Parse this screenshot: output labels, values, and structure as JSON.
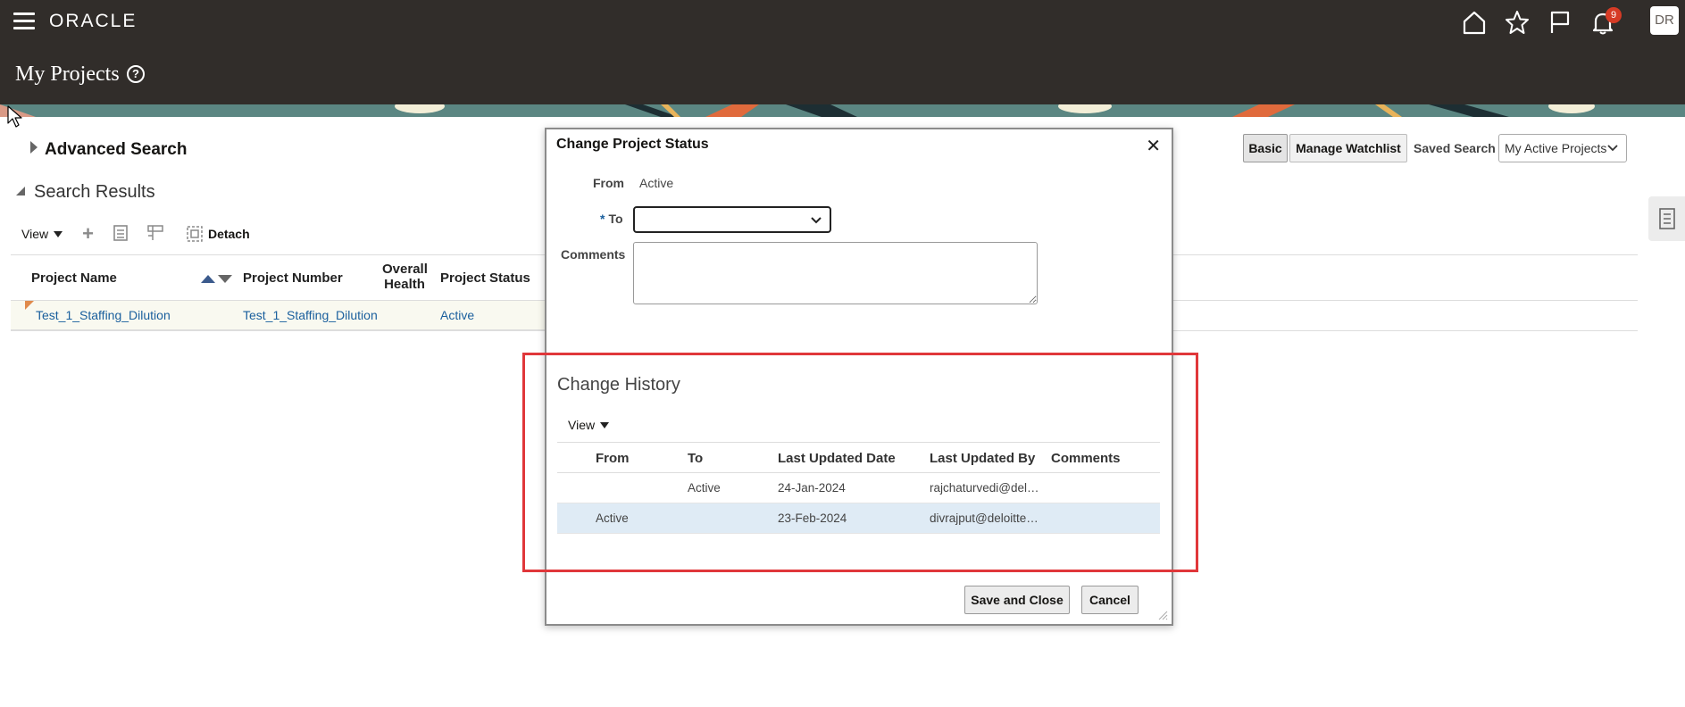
{
  "header": {
    "logo": "ORACLE",
    "page_title": "My Projects",
    "notification_count": "9",
    "avatar_initials": "DR",
    "colors": {
      "bar": "#312d2a",
      "badge": "#d63b25"
    }
  },
  "search": {
    "advanced_label": "Advanced Search",
    "results_label": "Search Results",
    "basic_button": "Basic",
    "watchlist_button": "Manage Watchlist",
    "saved_search_label": "Saved Search",
    "saved_search_value": "My Active Projects"
  },
  "toolbar": {
    "view_label": "View",
    "detach_label": "Detach"
  },
  "results_table": {
    "columns": {
      "name": "Project Name",
      "number": "Project Number",
      "health_line1": "Overall",
      "health_line2": "Health",
      "status": "Project Status"
    },
    "rows": [
      {
        "name": "Test_1_Staffing_Dilution",
        "number": "Test_1_Staffing_Dilution",
        "health": "",
        "status": "Active"
      }
    ]
  },
  "dialog": {
    "title": "Change Project Status",
    "from_label": "From",
    "from_value": "Active",
    "to_label": "To",
    "required_marker": "*",
    "to_value": "",
    "comments_label": "Comments",
    "comments_value": "",
    "save_button": "Save and Close",
    "cancel_button": "Cancel"
  },
  "change_history": {
    "title": "Change History",
    "view_label": "View",
    "columns": {
      "from": "From",
      "to": "To",
      "date": "Last Updated Date",
      "by": "Last Updated By",
      "comments": "Comments"
    },
    "rows": [
      {
        "from": "",
        "to": "Active",
        "date": "24-Jan-2024",
        "by": "rajchaturvedi@del…",
        "comments": ""
      },
      {
        "from": "Active",
        "to": "",
        "date": "23-Feb-2024",
        "by": "divrajput@deloitte…",
        "comments": ""
      }
    ]
  }
}
